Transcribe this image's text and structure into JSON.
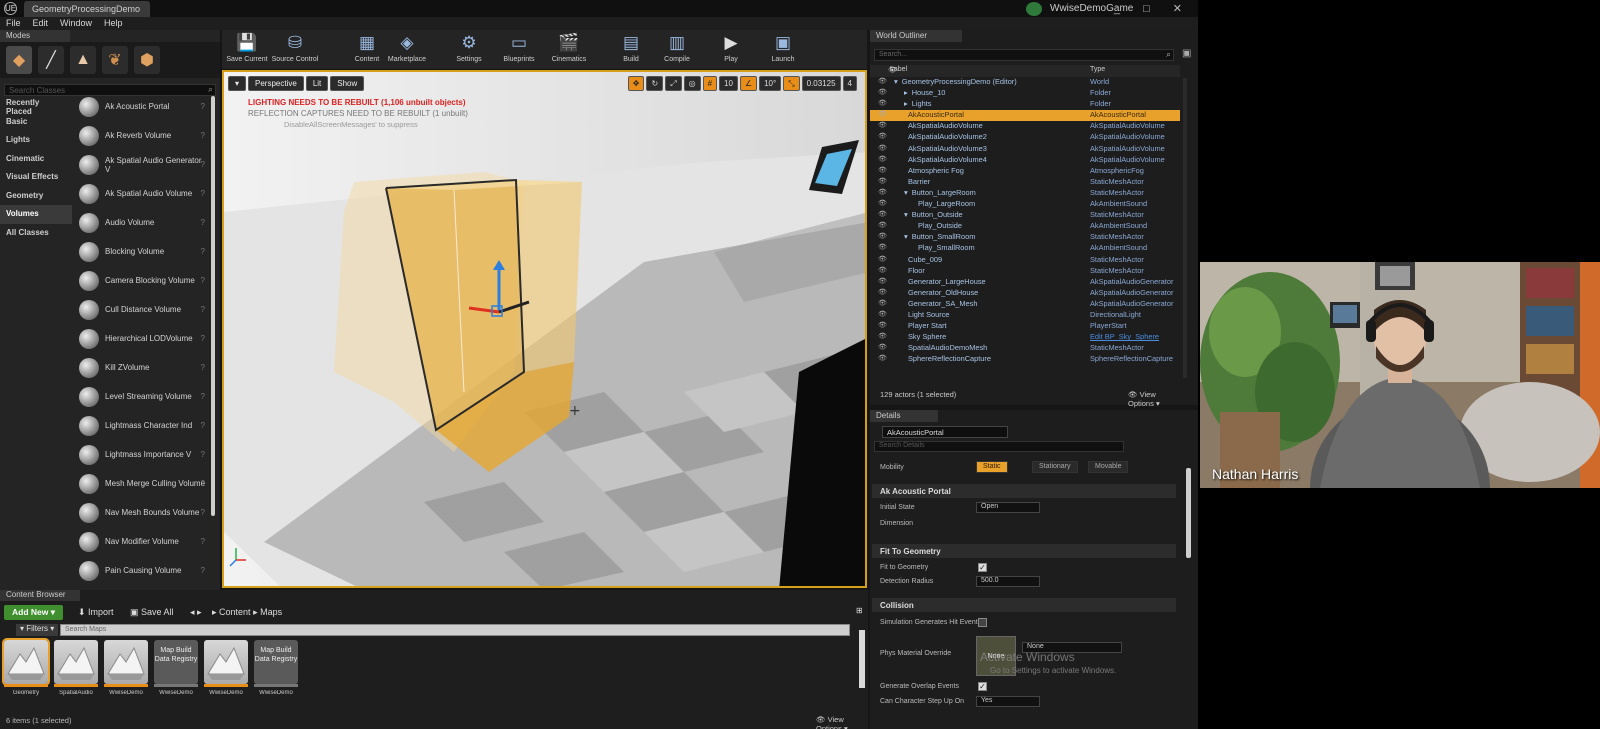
{
  "app": {
    "tab_title": "GeometryProcessingDemo",
    "project": "WwiseDemoGame",
    "logo": "UE",
    "window_controls": "_ □ ✕"
  },
  "menu": [
    "File",
    "Edit",
    "Window",
    "Help"
  ],
  "modes": {
    "tab": "Modes",
    "search_placeholder": "Search Classes",
    "categories": [
      "Recently Placed",
      "Basic",
      "Lights",
      "Cinematic",
      "Visual Effects",
      "Geometry",
      "Volumes",
      "All Classes"
    ],
    "selected_category": "Volumes",
    "volumes": [
      "Ak Acoustic Portal",
      "Ak Reverb Volume",
      "Ak Spatial Audio Generator V",
      "Ak Spatial Audio Volume",
      "Audio Volume",
      "Blocking Volume",
      "Camera Blocking Volume",
      "Cull Distance Volume",
      "Hierarchical LODVolume",
      "Kill ZVolume",
      "Level Streaming Volume",
      "Lightmass Character Ind",
      "Lightmass Importance V",
      "Mesh Merge Culling Volume",
      "Nav Mesh Bounds Volume",
      "Nav Modifier Volume",
      "Pain Causing Volume"
    ]
  },
  "toolbar": [
    {
      "label": "Save Current",
      "icon": "save-icon",
      "glyph": "💾"
    },
    {
      "label": "Source Control",
      "icon": "source-control-icon",
      "glyph": "⛁"
    },
    {
      "label": "Content",
      "icon": "content-icon",
      "glyph": "▦"
    },
    {
      "label": "Marketplace",
      "icon": "marketplace-icon",
      "glyph": "◈"
    },
    {
      "label": "Settings",
      "icon": "settings-icon",
      "glyph": "⚙"
    },
    {
      "label": "Blueprints",
      "icon": "blueprints-icon",
      "glyph": "▭"
    },
    {
      "label": "Cinematics",
      "icon": "cinematics-icon",
      "glyph": "🎬"
    },
    {
      "label": "Build",
      "icon": "build-icon",
      "glyph": "▤"
    },
    {
      "label": "Compile",
      "icon": "compile-icon",
      "glyph": "▥"
    },
    {
      "label": "Play",
      "icon": "play-icon",
      "glyph": "▶"
    },
    {
      "label": "Launch",
      "icon": "launch-icon",
      "glyph": "▣"
    }
  ],
  "viewport": {
    "perspective": "Perspective",
    "lit": "Lit",
    "show": "Show",
    "warning": "LIGHTING NEEDS TO BE REBUILT (1,106 unbuilt objects)",
    "warning2": "REFLECTION CAPTURES NEED TO BE REBUILT (1 unbuilt)",
    "warning3": "DisableAllScreenMessages' to suppress",
    "grid": "10",
    "angle": "10°",
    "scale": "0.03125",
    "speed": "4"
  },
  "outliner": {
    "tab": "World Outliner",
    "search_placeholder": "Search...",
    "col_label": "Label",
    "col_type": "Type",
    "rows": [
      {
        "label": "GeometryProcessingDemo (Editor)",
        "type": "World",
        "indent": 0,
        "icon": "▾"
      },
      {
        "label": "House_10",
        "type": "Folder",
        "indent": 1,
        "icon": "▸"
      },
      {
        "label": "Lights",
        "type": "Folder",
        "indent": 1,
        "icon": "▸"
      },
      {
        "label": "AkAcousticPortal",
        "type": "AkAcousticPortal",
        "indent": 1,
        "icon": "",
        "selected": true
      },
      {
        "label": "AkSpatialAudioVolume",
        "type": "AkSpatialAudioVolume",
        "indent": 1,
        "icon": ""
      },
      {
        "label": "AkSpatialAudioVolume2",
        "type": "AkSpatialAudioVolume",
        "indent": 1,
        "icon": ""
      },
      {
        "label": "AkSpatialAudioVolume3",
        "type": "AkSpatialAudioVolume",
        "indent": 1,
        "icon": ""
      },
      {
        "label": "AkSpatialAudioVolume4",
        "type": "AkSpatialAudioVolume",
        "indent": 1,
        "icon": ""
      },
      {
        "label": "Atmospheric Fog",
        "type": "AtmosphericFog",
        "indent": 1,
        "icon": ""
      },
      {
        "label": "Barrier",
        "type": "StaticMeshActor",
        "indent": 1,
        "icon": ""
      },
      {
        "label": "Button_LargeRoom",
        "type": "StaticMeshActor",
        "indent": 1,
        "icon": "▾"
      },
      {
        "label": "Play_LargeRoom",
        "type": "AkAmbientSound",
        "indent": 2,
        "icon": ""
      },
      {
        "label": "Button_Outside",
        "type": "StaticMeshActor",
        "indent": 1,
        "icon": "▾"
      },
      {
        "label": "Play_Outside",
        "type": "AkAmbientSound",
        "indent": 2,
        "icon": ""
      },
      {
        "label": "Button_SmallRoom",
        "type": "StaticMeshActor",
        "indent": 1,
        "icon": "▾"
      },
      {
        "label": "Play_SmallRoom",
        "type": "AkAmbientSound",
        "indent": 2,
        "icon": ""
      },
      {
        "label": "Cube_009",
        "type": "StaticMeshActor",
        "indent": 1,
        "icon": ""
      },
      {
        "label": "Floor",
        "type": "StaticMeshActor",
        "indent": 1,
        "icon": ""
      },
      {
        "label": "Generator_LargeHouse",
        "type": "AkSpatialAudioGenerator",
        "indent": 1,
        "icon": ""
      },
      {
        "label": "Generator_OldHouse",
        "type": "AkSpatialAudioGenerator",
        "indent": 1,
        "icon": ""
      },
      {
        "label": "Generator_SA_Mesh",
        "type": "AkSpatialAudioGenerator",
        "indent": 1,
        "icon": ""
      },
      {
        "label": "Light Source",
        "type": "DirectionalLight",
        "indent": 1,
        "icon": ""
      },
      {
        "label": "Player Start",
        "type": "PlayerStart",
        "indent": 1,
        "icon": ""
      },
      {
        "label": "Sky Sphere",
        "type": "Edit BP_Sky_Sphere",
        "indent": 1,
        "icon": "",
        "link": true
      },
      {
        "label": "SpatialAudioDemoMesh",
        "type": "StaticMeshActor",
        "indent": 1,
        "icon": ""
      },
      {
        "label": "SphereReflectionCapture",
        "type": "SphereReflectionCapture",
        "indent": 1,
        "icon": ""
      }
    ],
    "count": "129 actors (1 selected)",
    "view_options": "View Options"
  },
  "details": {
    "tab": "Details",
    "name": "AkAcousticPortal",
    "search_placeholder": "Search Details",
    "mobility_label": "Mobility",
    "mobility": [
      "Static",
      "Stationary",
      "Movable"
    ],
    "section1": "Ak Acoustic Portal",
    "initial_state_label": "Initial State",
    "initial_state": "Open",
    "dimensions_label": "Dimension",
    "section2": "Fit To Geometry",
    "fit_label": "Fit to Geometry",
    "detection_label": "Detection Radius",
    "detection_value": "500.0",
    "section3": "Collision",
    "sim_hit_label": "Simulation Generates Hit Events",
    "phys_label": "Phys Material Override",
    "phys_value": "None",
    "overlap_label": "Generate Overlap Events",
    "step_label": "Can Character Step Up On",
    "step_value": "Yes",
    "watermark": "Activate Windows",
    "watermark2": "Go to Settings to activate Windows."
  },
  "content_browser": {
    "tab": "Content Browser",
    "add_new": "Add New",
    "import": "Import",
    "save_all": "Save All",
    "path": [
      "Content",
      "Maps"
    ],
    "filters": "Filters",
    "search_placeholder": "Search Maps",
    "assets": [
      {
        "kind": "map",
        "caption": "Geometry",
        "selected": true
      },
      {
        "kind": "map",
        "caption": "SpatialAudio"
      },
      {
        "kind": "map",
        "caption": "WwiseDemo"
      },
      {
        "kind": "reg",
        "text": "Map Build Data Registry",
        "caption": "WwiseDemo"
      },
      {
        "kind": "map",
        "caption": "WwiseDemo"
      },
      {
        "kind": "reg",
        "text": "Map Build Data Registry",
        "caption": "WwiseDemo"
      }
    ],
    "status": "6 items (1 selected)",
    "view_options": "View Options"
  },
  "webcam": {
    "name": "Nathan Harris"
  }
}
